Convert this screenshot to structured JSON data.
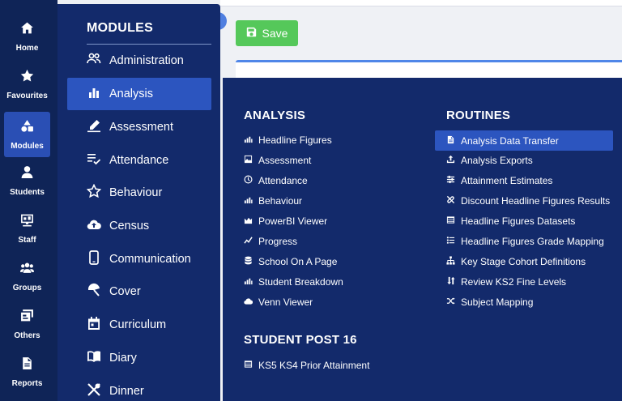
{
  "rail": {
    "items": [
      {
        "label": "Home",
        "icon": "home-icon"
      },
      {
        "label": "Favourites",
        "icon": "star-icon"
      },
      {
        "label": "Modules",
        "icon": "shapes-icon",
        "active": true
      },
      {
        "label": "Students",
        "icon": "person-icon"
      },
      {
        "label": "Staff",
        "icon": "chalkboard-icon"
      },
      {
        "label": "Groups",
        "icon": "group-icon"
      },
      {
        "label": "Others",
        "icon": "id-card-icon"
      },
      {
        "label": "Reports",
        "icon": "document-icon"
      }
    ]
  },
  "modules": {
    "title": "MODULES",
    "items": [
      {
        "label": "Administration",
        "icon": "users-icon"
      },
      {
        "label": "Analysis",
        "icon": "bar-chart-icon",
        "active": true
      },
      {
        "label": "Assessment",
        "icon": "pen-icon"
      },
      {
        "label": "Attendance",
        "icon": "list-check-icon"
      },
      {
        "label": "Behaviour",
        "icon": "star-outline-icon"
      },
      {
        "label": "Census",
        "icon": "cloud-upload-icon"
      },
      {
        "label": "Communication",
        "icon": "phone-icon"
      },
      {
        "label": "Cover",
        "icon": "umbrella-icon"
      },
      {
        "label": "Curriculum",
        "icon": "calendar-icon"
      },
      {
        "label": "Diary",
        "icon": "book-icon"
      },
      {
        "label": "Dinner",
        "icon": "utensils-icon"
      }
    ]
  },
  "toolbar": {
    "save_label": "Save"
  },
  "flyout": {
    "analysis": {
      "title": "ANALYSIS",
      "items": [
        {
          "label": "Headline Figures",
          "icon": "bar-chart-icon"
        },
        {
          "label": "Assessment",
          "icon": "image-icon"
        },
        {
          "label": "Attendance",
          "icon": "clock-icon"
        },
        {
          "label": "Behaviour",
          "icon": "bar-chart-icon"
        },
        {
          "label": "PowerBI Viewer",
          "icon": "area-chart-icon"
        },
        {
          "label": "Progress",
          "icon": "line-chart-icon"
        },
        {
          "label": "School On A Page",
          "icon": "database-icon"
        },
        {
          "label": "Student Breakdown",
          "icon": "bar-chart-icon"
        },
        {
          "label": "Venn Viewer",
          "icon": "cloud-icon"
        }
      ]
    },
    "student_post16": {
      "title": "STUDENT POST 16",
      "items": [
        {
          "label": "KS5 KS4 Prior Attainment",
          "icon": "table-icon"
        }
      ]
    },
    "routines": {
      "title": "ROUTINES",
      "items": [
        {
          "label": "Analysis Data Transfer",
          "icon": "file-icon",
          "active": true
        },
        {
          "label": "Analysis Exports",
          "icon": "upload-icon"
        },
        {
          "label": "Attainment Estimates",
          "icon": "sliders-icon"
        },
        {
          "label": "Discount Headline Figures Results",
          "icon": "unlink-icon"
        },
        {
          "label": "Headline Figures Datasets",
          "icon": "table-icon"
        },
        {
          "label": "Headline Figures Grade Mapping",
          "icon": "list-icon"
        },
        {
          "label": "Key Stage Cohort Definitions",
          "icon": "sitemap-icon"
        },
        {
          "label": "Review KS2 Fine Levels",
          "icon": "sort-icon"
        },
        {
          "label": "Subject Mapping",
          "icon": "shuffle-icon"
        }
      ]
    }
  }
}
